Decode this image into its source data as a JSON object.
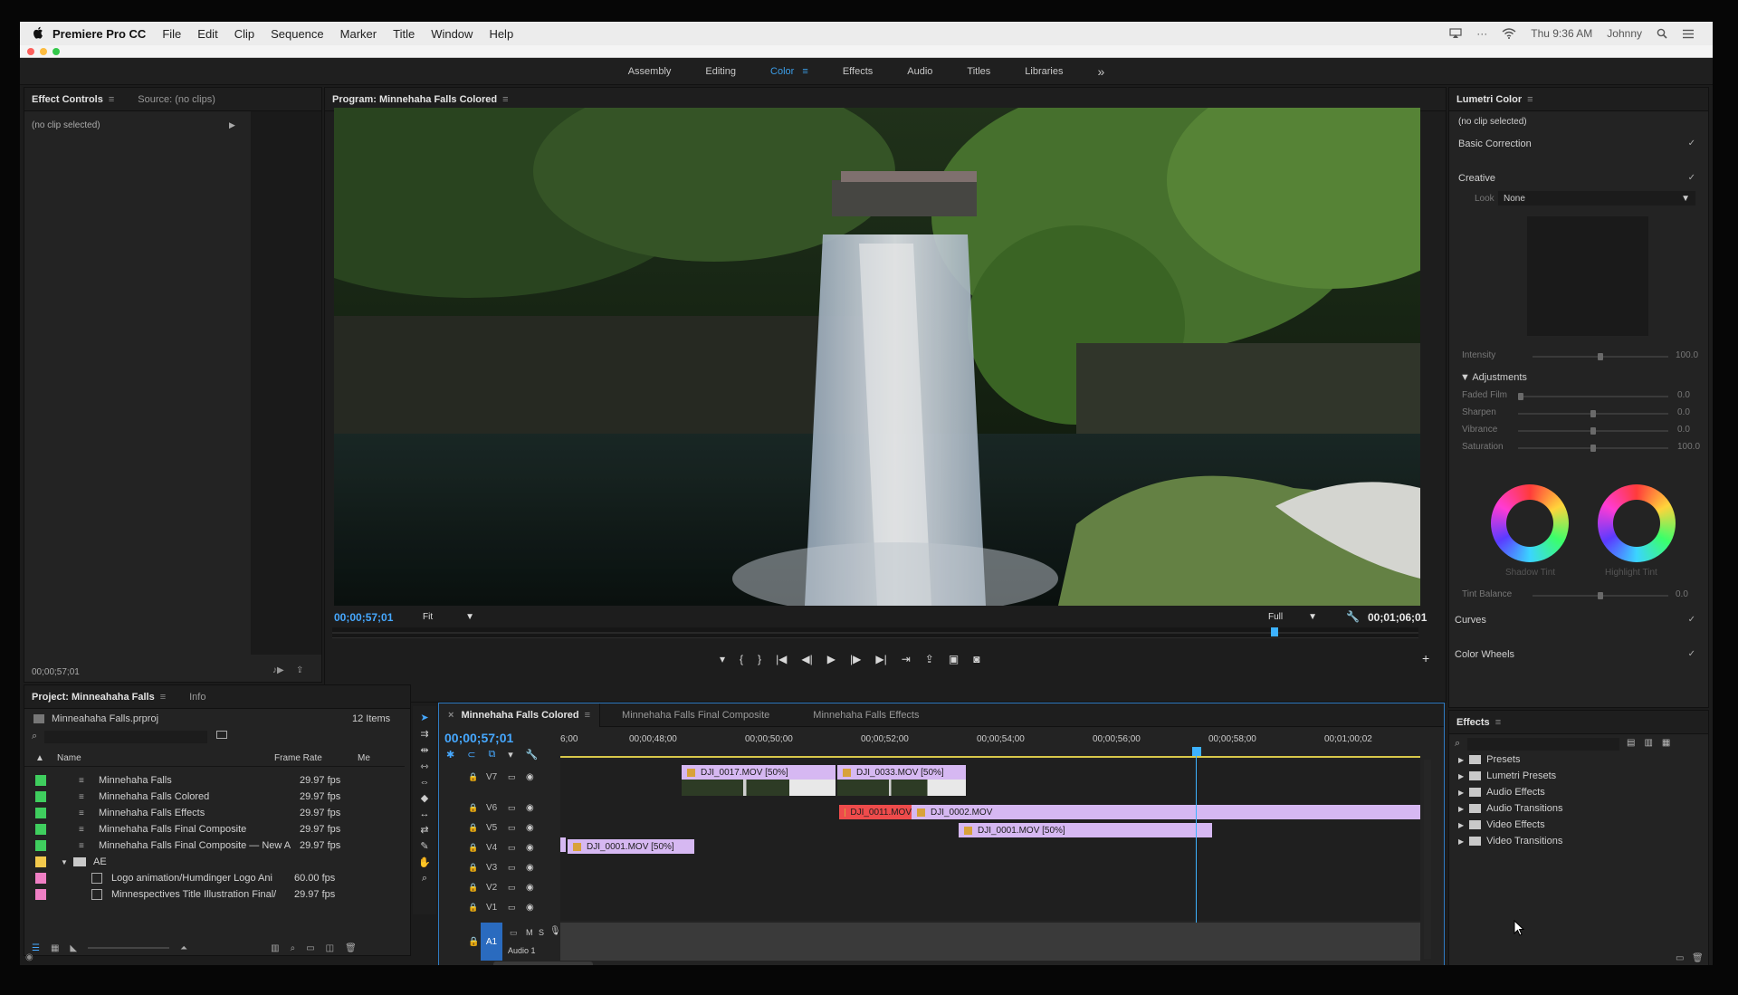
{
  "menubar": {
    "app_name": "Premiere Pro CC",
    "items": [
      "File",
      "Edit",
      "Clip",
      "Sequence",
      "Marker",
      "Title",
      "Window",
      "Help"
    ],
    "clock": "Thu 9:36 AM",
    "user": "Johnny"
  },
  "workspaces": {
    "tabs": [
      {
        "label": "Assembly",
        "active": false
      },
      {
        "label": "Editing",
        "active": false
      },
      {
        "label": "Color",
        "active": true
      },
      {
        "label": "Effects",
        "active": false
      },
      {
        "label": "Audio",
        "active": false
      },
      {
        "label": "Titles",
        "active": false
      },
      {
        "label": "Libraries",
        "active": false
      }
    ],
    "more": "»"
  },
  "effect_controls": {
    "tab_active": "Effect Controls",
    "tab_source": "Source: (no clips)",
    "no_clip": "(no clip selected)",
    "timecode": "00;00;57;01"
  },
  "program_monitor": {
    "title": "Program: Minnehaha Falls Colored",
    "timecode": "00;00;57;01",
    "zoom": "Fit",
    "resolution": "Full",
    "duration": "00;01;06;01",
    "playhead_fraction": 0.864
  },
  "lumetri": {
    "title": "Lumetri Color",
    "no_clip": "(no clip selected)",
    "basic_correction": "Basic Correction",
    "creative": "Creative",
    "look_label": "Look",
    "look_value": "None",
    "intensity_label": "Intensity",
    "intensity_value": "100.0",
    "adjustments": "Adjustments",
    "sliders": [
      {
        "label": "Faded Film",
        "value": "0.0",
        "fraction": 0.0
      },
      {
        "label": "Sharpen",
        "value": "0.0",
        "fraction": 0.5
      },
      {
        "label": "Vibrance",
        "value": "0.0",
        "fraction": 0.5
      },
      {
        "label": "Saturation",
        "value": "100.0",
        "fraction": 0.5
      }
    ],
    "shadow_tint": "Shadow Tint",
    "highlight_tint": "Highlight Tint",
    "tint_balance_label": "Tint Balance",
    "tint_balance_value": "0.0",
    "curves": "Curves",
    "color_wheels": "Color Wheels",
    "check": "✓"
  },
  "project": {
    "tab_active": "Project: Minneahaha Falls",
    "tab_info": "Info",
    "file": "Minneahaha Falls.prproj",
    "count": "12 Items",
    "col_name": "Name",
    "col_rate": "Frame Rate",
    "col_more": "Me",
    "items": [
      {
        "name": "Minnehaha Falls",
        "rate": "29.97 fps",
        "color": "#3fce5e",
        "type": "sequence",
        "indent": 0
      },
      {
        "name": "Minnehaha Falls Colored",
        "rate": "29.97 fps",
        "color": "#3fce5e",
        "type": "sequence",
        "indent": 0
      },
      {
        "name": "Minnehaha Falls Effects",
        "rate": "29.97 fps",
        "color": "#3fce5e",
        "type": "sequence",
        "indent": 0
      },
      {
        "name": "Minnehaha Falls Final Composite",
        "rate": "29.97 fps",
        "color": "#3fce5e",
        "type": "sequence",
        "indent": 0
      },
      {
        "name": "Minnehaha Falls Final Composite — New A",
        "rate": "29.97 fps",
        "color": "#3fce5e",
        "type": "sequence",
        "indent": 0
      },
      {
        "name": "AE",
        "rate": "",
        "color": "#f2c94c",
        "type": "folder",
        "indent": 0
      },
      {
        "name": "Logo animation/Humdinger Logo Ani",
        "rate": "60.00 fps",
        "color": "#ef7fc4",
        "type": "comp",
        "indent": 1
      },
      {
        "name": "Minnespectives Title Illustration Final/",
        "rate": "29.97 fps",
        "color": "#ef7fc4",
        "type": "comp",
        "indent": 1
      }
    ]
  },
  "timeline": {
    "tabs": [
      {
        "label": "Minnehaha Falls Colored",
        "active": true
      },
      {
        "label": "Minnehaha Falls Final Composite",
        "active": false
      },
      {
        "label": "Minnehaha Falls Effects",
        "active": false
      }
    ],
    "timecode": "00;00;57;01",
    "ruler": [
      "6;00",
      "00;00;48;00",
      "00;00;50;00",
      "00;00;52;00",
      "00;00;54;00",
      "00;00;56;00",
      "00;00;58;00",
      "00;01;00;02"
    ],
    "tracks": [
      "V7",
      "V6",
      "V5",
      "V4",
      "V3",
      "V2",
      "V1"
    ],
    "audio_track": "A1",
    "audio_name": "Audio 1",
    "audio_buttons": [
      "M",
      "S"
    ],
    "clips": [
      {
        "label": "DJI_0017.MOV [50%]",
        "color": "#d6b8f2",
        "track": 0
      },
      {
        "label": "DJI_0033.MOV [50%]",
        "color": "#d6b8f2",
        "track": 0
      },
      {
        "label": "DJI_0011.MOV",
        "color": "#ee4b4b",
        "track": 2
      },
      {
        "label": "DJI_0002.MOV",
        "color": "#d6b8f2",
        "track": 2
      },
      {
        "label": "DJI_0001.MOV [50%]",
        "color": "#d6b8f2",
        "track": 3
      },
      {
        "label": "DJI_0001.MOV [50%]",
        "color": "#d6b8f2",
        "track": 4
      }
    ]
  },
  "effects": {
    "title": "Effects",
    "items": [
      "Presets",
      "Lumetri Presets",
      "Audio Effects",
      "Audio Transitions",
      "Video Effects",
      "Video Transitions"
    ]
  }
}
